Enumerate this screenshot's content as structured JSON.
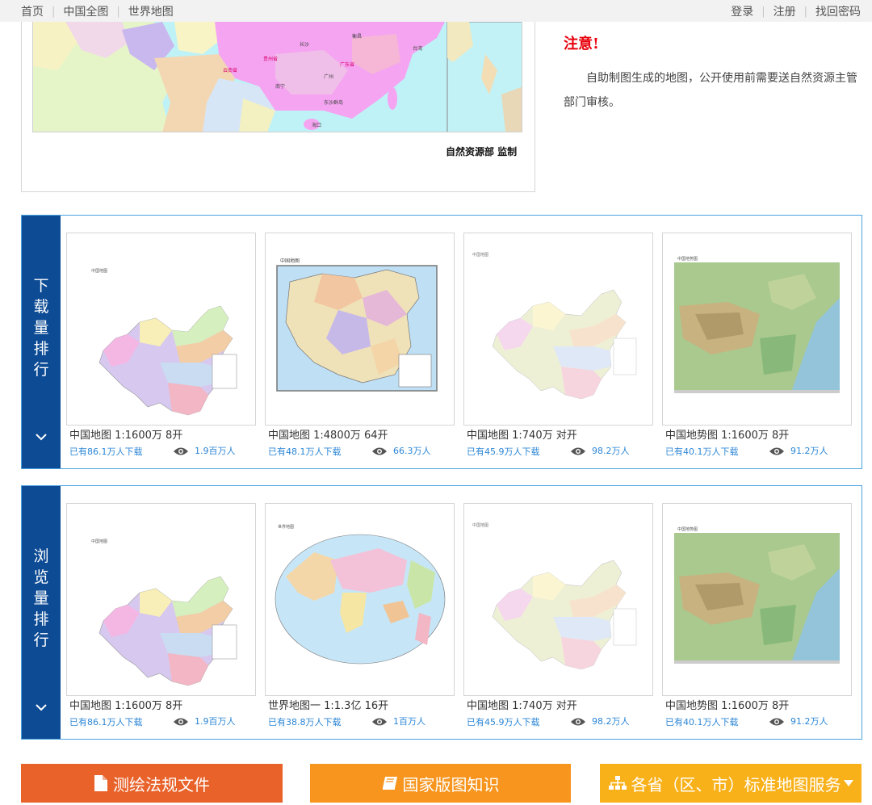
{
  "nav": {
    "left": [
      "首页",
      "中国全图",
      "世界地图"
    ],
    "right": [
      "登录",
      "注册",
      "找回密码"
    ]
  },
  "hero": {
    "credit": "自然资源部 监制"
  },
  "notice": {
    "title": "注意!",
    "body": "自助制图生成的地图，公开使用前需要送自然资源主管部门审核。"
  },
  "download_ranking": {
    "title": "下\n载\n量\n排\n行",
    "cards": [
      {
        "name": "中国地图 1:1600万 8开",
        "downloads": "已有86.1万人下载",
        "views": "1.9百万人",
        "thumb": "china-admin"
      },
      {
        "name": "中国地图 1:4800万 64开",
        "downloads": "已有48.1万人下载",
        "views": "66.3万人",
        "thumb": "china-framed"
      },
      {
        "name": "中国地图 1:740万 对开",
        "downloads": "已有45.9万人下载",
        "views": "98.2万人",
        "thumb": "china-light"
      },
      {
        "name": "中国地势图 1:1600万 8开",
        "downloads": "已有40.1万人下载",
        "views": "91.2万人",
        "thumb": "china-terrain"
      }
    ]
  },
  "view_ranking": {
    "title": "浏\n览\n量\n排\n行",
    "cards": [
      {
        "name": "中国地图 1:1600万 8开",
        "downloads": "已有86.1万人下载",
        "views": "1.9百万人",
        "thumb": "china-admin"
      },
      {
        "name": "世界地图一 1:1.3亿 16开",
        "downloads": "已有38.8万人下载",
        "views": "1百万人",
        "thumb": "world"
      },
      {
        "name": "中国地图 1:740万 对开",
        "downloads": "已有45.9万人下载",
        "views": "98.2万人",
        "thumb": "china-light"
      },
      {
        "name": "中国地势图 1:1600万 8开",
        "downloads": "已有40.1万人下载",
        "views": "91.2万人",
        "thumb": "china-terrain"
      }
    ]
  },
  "buttons": {
    "laws": "测绘法规文件",
    "knowledge": "国家版图知识",
    "province": "各省（区、市）标准地图服务"
  },
  "colors": {
    "panel_side": "#0d4b94",
    "panel_border": "#4aa3df",
    "link_blue": "#2b86d6",
    "notice_red": "#e8000b",
    "btn_laws": "#e8622a",
    "btn_knowledge": "#f7951e",
    "btn_province": "#f9b11a"
  },
  "icons": {
    "views": "eye-icon",
    "collapse": "chevron-down-icon",
    "laws": "file-icon",
    "knowledge": "book-icon",
    "province": "sitemap-icon",
    "dropdown": "caret-down-icon"
  }
}
